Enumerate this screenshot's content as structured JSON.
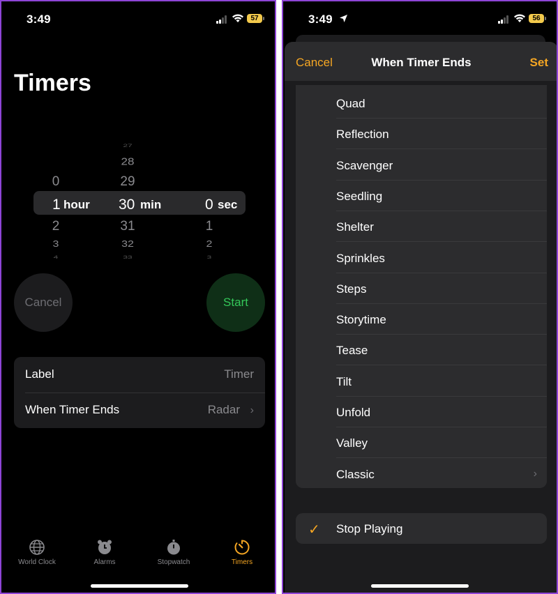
{
  "left": {
    "status": {
      "time": "3:49",
      "battery": "57"
    },
    "title": "Timers",
    "picker": {
      "hours_above": [
        "0"
      ],
      "hours_selected": "1",
      "hours_unit": "hour",
      "hours_below": [
        "2",
        "3",
        "4"
      ],
      "mins_above": [
        "27",
        "28",
        "29"
      ],
      "mins_selected": "30",
      "mins_unit": "min",
      "mins_below": [
        "31",
        "32",
        "33"
      ],
      "secs_selected": "0",
      "secs_unit": "sec",
      "secs_below": [
        "1",
        "2",
        "3"
      ]
    },
    "cancel_label": "Cancel",
    "start_label": "Start",
    "settings": {
      "label_title": "Label",
      "label_value": "Timer",
      "ends_title": "When Timer Ends",
      "ends_value": "Radar"
    },
    "tabs": [
      {
        "label": "World Clock",
        "icon": "globe-icon"
      },
      {
        "label": "Alarms",
        "icon": "alarm-clock-icon"
      },
      {
        "label": "Stopwatch",
        "icon": "stopwatch-icon"
      },
      {
        "label": "Timers",
        "icon": "timer-icon"
      }
    ],
    "accent": "#f5a623"
  },
  "right": {
    "status": {
      "time": "3:49",
      "battery": "56"
    },
    "nav": {
      "cancel": "Cancel",
      "title": "When Timer Ends",
      "set": "Set"
    },
    "sounds": [
      "Quad",
      "Reflection",
      "Scavenger",
      "Seedling",
      "Shelter",
      "Sprinkles",
      "Steps",
      "Storytime",
      "Tease",
      "Tilt",
      "Unfold",
      "Valley",
      "Classic"
    ],
    "stop_playing": "Stop Playing"
  }
}
